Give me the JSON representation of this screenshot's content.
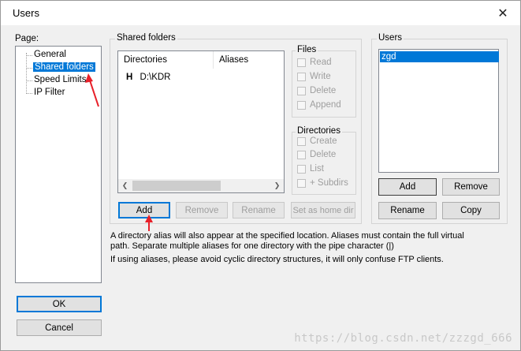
{
  "window": {
    "title": "Users",
    "close_glyph": "✕"
  },
  "page_panel": {
    "label": "Page:",
    "items": [
      {
        "label": "General",
        "selected": false
      },
      {
        "label": "Shared folders",
        "selected": true
      },
      {
        "label": "Speed Limits",
        "selected": false
      },
      {
        "label": "IP Filter",
        "selected": false
      }
    ]
  },
  "shared_folders": {
    "title": "Shared folders",
    "columns": [
      "Directories",
      "Aliases"
    ],
    "rows": [
      {
        "marker": "H",
        "directory": "D:\\KDR",
        "alias": ""
      }
    ],
    "buttons": {
      "add": "Add",
      "remove": "Remove",
      "rename": "Rename",
      "set_home": "Set as home dir"
    }
  },
  "files": {
    "title": "Files",
    "options": [
      "Read",
      "Write",
      "Delete",
      "Append"
    ]
  },
  "directories": {
    "title": "Directories",
    "options": [
      "Create",
      "Delete",
      "List",
      "+ Subdirs"
    ]
  },
  "users": {
    "title": "Users",
    "list": [
      {
        "name": "zgd",
        "selected": true
      }
    ],
    "buttons": {
      "add": "Add",
      "remove": "Remove",
      "rename": "Rename",
      "copy": "Copy"
    }
  },
  "description": {
    "line1": "A directory alias will also appear at the specified location. Aliases must contain the full virtual",
    "line2": "path. Separate multiple aliases for one directory with the pipe character (|)",
    "line3": "If using aliases, please avoid cyclic directory structures, it will only confuse FTP clients."
  },
  "dialog_buttons": {
    "ok": "OK",
    "cancel": "Cancel"
  },
  "watermark": "https://blog.csdn.net/zzzgd_666",
  "colors": {
    "selection": "#0078d7",
    "annotation_arrow": "#e8202a"
  }
}
